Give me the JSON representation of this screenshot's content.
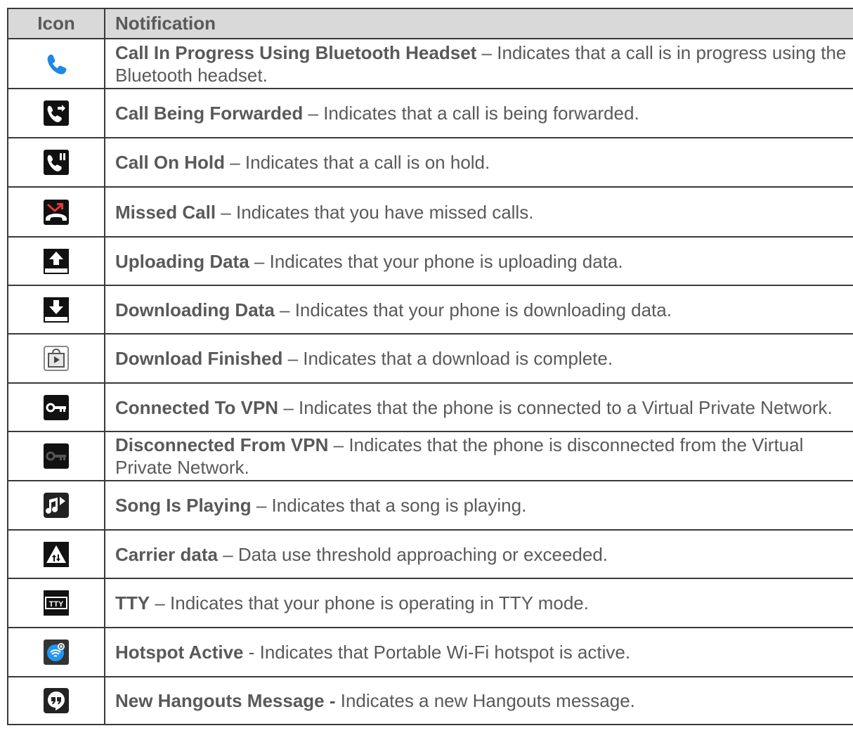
{
  "header": {
    "icon": "Icon",
    "notification": "Notification"
  },
  "rows": [
    {
      "icon": "bluetooth-call-icon",
      "title": "Call In Progress Using Bluetooth Headset",
      "sep": " – ",
      "desc": "Indicates that a call is in progress using the Bluetooth headset."
    },
    {
      "icon": "call-forward-icon",
      "title": "Call Being Forwarded",
      "sep": " – ",
      "desc": "Indicates that a call is being forwarded."
    },
    {
      "icon": "call-hold-icon",
      "title": "Call On Hold",
      "sep": " – ",
      "desc": "Indicates that a call is on hold."
    },
    {
      "icon": "missed-call-icon",
      "title": "Missed Call",
      "sep": " – ",
      "desc": "Indicates that you have missed calls."
    },
    {
      "icon": "upload-icon",
      "title": "Uploading Data",
      "sep": " – ",
      "desc": "Indicates that your phone is uploading data."
    },
    {
      "icon": "download-icon",
      "title": "Downloading Data",
      "sep": " – ",
      "desc": "Indicates that your phone is downloading data."
    },
    {
      "icon": "download-finished-icon",
      "title": "Download Finished",
      "sep": " – ",
      "desc": "Indicates that a download is complete."
    },
    {
      "icon": "vpn-connected-icon",
      "title": "Connected To VPN",
      "sep": " – ",
      "desc": "Indicates that the phone is connected to a Virtual Private Network."
    },
    {
      "icon": "vpn-disconnected-icon",
      "title": "Disconnected From VPN",
      "sep": " – ",
      "desc": "Indicates that the phone is disconnected from the Virtual Private Network."
    },
    {
      "icon": "song-playing-icon",
      "title": "Song Is Playing",
      "sep": " – ",
      "desc": "Indicates that a song is playing."
    },
    {
      "icon": "carrier-data-icon",
      "title": "Carrier data",
      "sep": " – ",
      "desc": "Data use threshold approaching or exceeded."
    },
    {
      "icon": "tty-icon",
      "title": "TTY",
      "sep": " – ",
      "desc": "Indicates that your phone is operating in TTY mode."
    },
    {
      "icon": "hotspot-icon",
      "title": "Hotspot Active",
      "sep": " - ",
      "desc": "Indicates that Portable Wi-Fi hotspot is active."
    },
    {
      "icon": "hangouts-icon",
      "title": "New Hangouts Message -",
      "sep": " ",
      "desc": "Indicates a new Hangouts message."
    }
  ],
  "icon_labels": {
    "tty": "TTY"
  },
  "colors": {
    "header_bg": "#d9d9d9",
    "text": "#595959",
    "border": "#3a3a3a",
    "call_blue": "#1e88e5",
    "hotspot_blue": "#2196f3",
    "missed_red": "#e53935"
  }
}
